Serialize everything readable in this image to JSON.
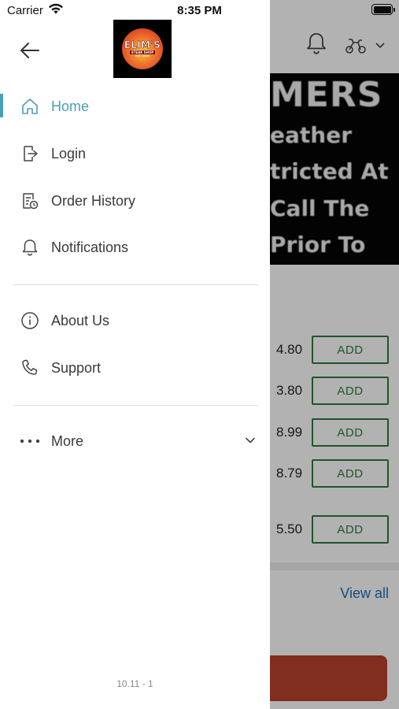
{
  "status_bar": {
    "carrier": "Carrier",
    "time": "8:35 PM"
  },
  "drawer": {
    "logo_text": "ELIM'S",
    "logo_subtext": "STEAK SHOP",
    "logo_est": "EST. 2016",
    "menu": [
      {
        "label": "Home",
        "icon": "home-icon",
        "active": true
      },
      {
        "label": "Login",
        "icon": "login-icon"
      },
      {
        "label": "Order History",
        "icon": "order-history-icon"
      },
      {
        "label": "Notifications",
        "icon": "bell-icon"
      }
    ],
    "secondary_menu": [
      {
        "label": "About Us",
        "icon": "info-icon"
      },
      {
        "label": "Support",
        "icon": "phone-icon"
      }
    ],
    "more": {
      "label": "More",
      "icon": "more-dots-icon"
    },
    "version": "10.11 - 1",
    "accent_color": "#4a9fb8"
  },
  "background": {
    "banner_lines": [
      "MERS",
      "eather",
      "tricted At",
      "Call The",
      "Prior To"
    ],
    "prices": [
      "4.80",
      "3.80",
      "8.99",
      "8.79",
      "5.50"
    ],
    "add_label": "ADD",
    "view_all": "View all",
    "add_color": "#2f7a3c",
    "cart_color": "#b9412e"
  }
}
